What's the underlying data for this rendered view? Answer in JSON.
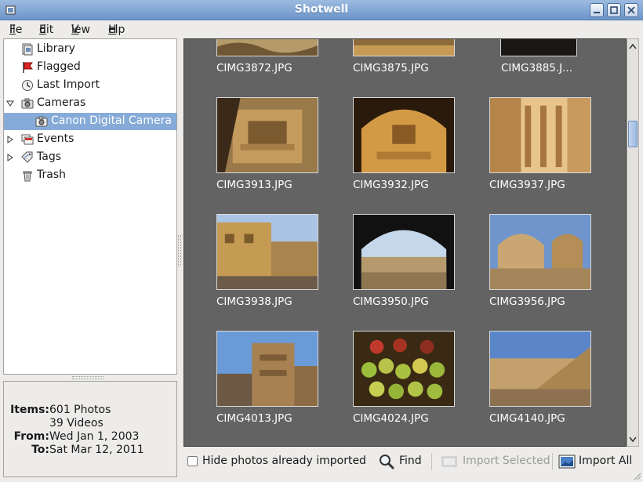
{
  "window": {
    "title": "Shotwell",
    "controls": [
      "minimize",
      "maximize",
      "close"
    ]
  },
  "menu": {
    "items": [
      {
        "label": "File",
        "mnemonic": "F",
        "rest": "ile"
      },
      {
        "label": "Edit",
        "mnemonic": "E",
        "rest": "dit"
      },
      {
        "label": "View",
        "mnemonic": "V",
        "rest": "iew"
      },
      {
        "label": "Help",
        "mnemonic": "H",
        "rest": "elp"
      }
    ]
  },
  "sidebar": {
    "items": [
      {
        "label": "Library",
        "icon": "library-icon"
      },
      {
        "label": "Flagged",
        "icon": "flag-icon"
      },
      {
        "label": "Last Import",
        "icon": "last-import-icon"
      },
      {
        "label": "Cameras",
        "icon": "camera-icon",
        "expanded": true
      },
      {
        "label": "Canon Digital Camera",
        "icon": "camera-icon",
        "selected": true
      },
      {
        "label": "Events",
        "icon": "events-icon",
        "expanded": false
      },
      {
        "label": "Tags",
        "icon": "tag-icon",
        "expanded": false
      },
      {
        "label": "Trash",
        "icon": "trash-icon"
      }
    ]
  },
  "info": {
    "items_label": "Items:",
    "photos": "601 Photos",
    "videos": "39 Videos",
    "from_label": "From:",
    "from": "Wed Jan 1, 2003",
    "to_label": "To:",
    "to": "Sat Mar 12, 2011"
  },
  "photos": {
    "row0": [
      "CIMG3872.JPG",
      "CIMG3875.JPG",
      "CIMG3885.J..."
    ],
    "row1": [
      "CIMG3913.JPG",
      "CIMG3932.JPG",
      "CIMG3937.JPG"
    ],
    "row2": [
      "CIMG3938.JPG",
      "CIMG3950.JPG",
      "CIMG3956.JPG"
    ],
    "row3": [
      "CIMG4013.JPG",
      "CIMG4024.JPG",
      "CIMG4140.JPG"
    ]
  },
  "toolbar": {
    "hide_imported": "Hide photos already imported",
    "hide_imported_checked": false,
    "find": "Find",
    "import_selected": "Import Selected",
    "import_all": "Import All"
  },
  "colors": {
    "viewer_bg": "#636363",
    "selection": "#86abd9",
    "titlebar": "#7ba0d2"
  }
}
